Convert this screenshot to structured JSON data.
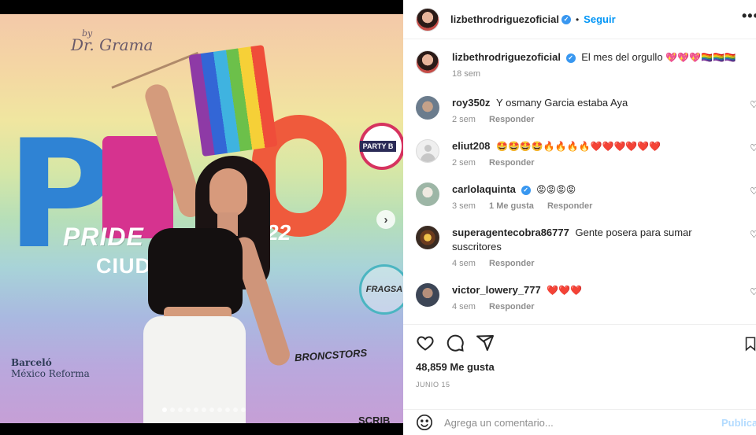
{
  "post": {
    "username": "lizbethrodriguezoficial",
    "follow_label": "Seguir",
    "separator": "•",
    "more_icon": "more-horizontal-icon",
    "media": {
      "banner_brand_top": "Dr. Grama",
      "banner_brand_top_small": "by",
      "banner_pride": "PRIDE",
      "banner_year": "22",
      "banner_city": "CIUDAL",
      "banner_party": "PARTY B",
      "banner_frag": "FRAGSA",
      "banner_barcelo_1": "Barceló",
      "banner_barcelo_2": "México Reforma",
      "banner_broncs": "BRONCSTORS",
      "banner_scrib": "SCRIB",
      "next_icon": "chevron-right-icon",
      "dot_count": 11,
      "active_dot": 0
    }
  },
  "caption": {
    "username": "lizbethrodriguezoficial",
    "text": "El mes del orgullo",
    "emojis": "💖💖💖🏳️‍🌈🏳️‍🌈🏳️‍🌈",
    "time": "18 sem"
  },
  "comments": [
    {
      "username": "roy350z",
      "text": "Y osmany Garcia estaba Aya",
      "time": "2 sem",
      "likes": "",
      "reply": "Responder",
      "verified": false
    },
    {
      "username": "eliut208",
      "text": "🤩🤩🤩🤩🔥🔥🔥🔥❤️❤️❤️❤️❤️❤️",
      "time": "2 sem",
      "likes": "",
      "reply": "Responder",
      "verified": false
    },
    {
      "username": "carlolaquinta",
      "text": "😡😡😡😡",
      "time": "3 sem",
      "likes": "1 Me gusta",
      "reply": "Responder",
      "verified": true
    },
    {
      "username": "superagentecobra86777",
      "text": "Gente posera para sumar suscritores",
      "time": "4 sem",
      "likes": "",
      "reply": "Responder",
      "verified": false
    },
    {
      "username": "victor_lowery_777",
      "text": "❤️❤️❤️",
      "time": "4 sem",
      "likes": "",
      "reply": "Responder",
      "verified": false
    }
  ],
  "stats": {
    "likes": "48,859 Me gusta",
    "date": "JUNIO 15"
  },
  "add_comment": {
    "placeholder": "Agrega un comentario...",
    "publish": "Publicar",
    "emoji_icon": "smile-icon"
  },
  "colors": {
    "accent": "#0095f6",
    "verified": "#3897f0",
    "muted": "#8e8e8e",
    "publish_disabled": "#b3dbff"
  }
}
